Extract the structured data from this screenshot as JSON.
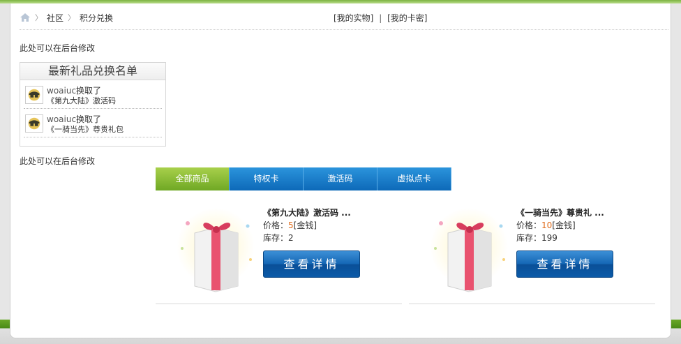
{
  "breadcrumb": {
    "items": [
      "社区",
      "积分兑换"
    ]
  },
  "toplinks": {
    "real_goods": "[我的实物]",
    "sep": "|",
    "card_keys": "[我的卡密]"
  },
  "notes": {
    "top": "此处可以在后台修改",
    "bottom": "此处可以在后台修改"
  },
  "rank": {
    "title": "最新礼品兑换名单",
    "items": [
      {
        "user": "woaiuc",
        "action": "换取了",
        "gift": "《第九大陆》激活码"
      },
      {
        "user": "woaiuc",
        "action": "换取了",
        "gift": "《一骑当先》尊贵礼包"
      }
    ]
  },
  "tabs": [
    "全部商品",
    "特权卡",
    "激活码",
    "虚拟点卡"
  ],
  "products": [
    {
      "name": "《第九大陆》激活码 ...",
      "price_label": "价格：",
      "price": "5",
      "currency": "[金钱]",
      "stock_label": "库存：",
      "stock": "2",
      "button": "查看详情"
    },
    {
      "name": "《一骑当先》尊贵礼 ...",
      "price_label": "价格：",
      "price": "10",
      "currency": "[金钱]",
      "stock_label": "库存：",
      "stock": "199",
      "button": "查看详情"
    }
  ],
  "colors": {
    "accent_green": "#7cb342",
    "tab_blue": "#0d69b8",
    "price_orange": "#e06b1a"
  },
  "icons": [
    "home-icon",
    "chevron-right-icon",
    "avatar-icon",
    "gift-box-icon"
  ]
}
